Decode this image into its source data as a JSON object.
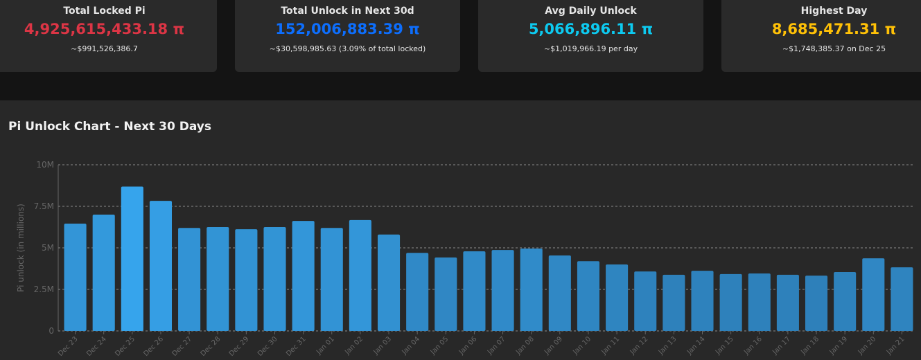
{
  "cards": [
    {
      "title": "Total Locked Pi",
      "value": "4,925,615,433.18 π",
      "sub": "~$991,526,386.7",
      "color": "#dc3545"
    },
    {
      "title": "Total Unlock in Next 30d",
      "value": "152,006,883.39 π",
      "sub": "~$30,598,985.63 (3.09% of total locked)",
      "color": "#0d6efd"
    },
    {
      "title": "Avg Daily Unlock",
      "value": "5,066,896.11 π",
      "sub": "~$1,019,966.19 per day",
      "color": "#0dcaf0"
    },
    {
      "title": "Highest Day",
      "value": "8,685,471.31 π",
      "sub": "~$1,748,385.37 on Dec 25",
      "color": "#ffc107"
    }
  ],
  "chart_data": {
    "type": "bar",
    "title": "Pi Unlock Chart - Next 30 Days",
    "xlabel": "",
    "ylabel": "Pi unlock (in millions)",
    "ylim": [
      0,
      10000000
    ],
    "yticks": [
      {
        "v": 0,
        "label": "0"
      },
      {
        "v": 2500000,
        "label": "2.5M"
      },
      {
        "v": 5000000,
        "label": "5M"
      },
      {
        "v": 7500000,
        "label": "7.5M"
      },
      {
        "v": 10000000,
        "label": "10M"
      }
    ],
    "categories": [
      "Dec 23",
      "Dec 24",
      "Dec 25",
      "Dec 26",
      "Dec 27",
      "Dec 28",
      "Dec 29",
      "Dec 30",
      "Dec 31",
      "Jan 01",
      "Jan 02",
      "Jan 03",
      "Jan 04",
      "Jan 05",
      "Jan 06",
      "Jan 07",
      "Jan 08",
      "Jan 09",
      "Jan 10",
      "Jan 11",
      "Jan 12",
      "Jan 13",
      "Jan 14",
      "Jan 15",
      "Jan 16",
      "Jan 17",
      "Jan 18",
      "Jan 19",
      "Jan 20",
      "Jan 21"
    ],
    "values": [
      6460000,
      7000000,
      8685471,
      7830000,
      6200000,
      6250000,
      6120000,
      6250000,
      6620000,
      6200000,
      6670000,
      5800000,
      4700000,
      4420000,
      4790000,
      4870000,
      4960000,
      4540000,
      4200000,
      4000000,
      3580000,
      3380000,
      3620000,
      3420000,
      3460000,
      3380000,
      3330000,
      3540000,
      4370000,
      3830000
    ],
    "grid": true
  }
}
